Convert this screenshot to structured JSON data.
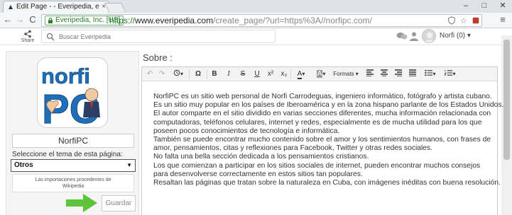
{
  "browser": {
    "tab_title": "Edit Page - - Everipedia, e",
    "tab_close": "×",
    "window_minimize": "–",
    "window_maximize": "□",
    "window_close": "✕",
    "back": "←",
    "forward": "→",
    "reload": "C",
    "ev_badge": "Everipedia, Inc. [US]",
    "url_https": "https://",
    "url_domain": "www.everipedia.com",
    "url_path": "/create_page/?url=https%3A//norfipc.com/",
    "menu": "≡"
  },
  "site": {
    "share_label": "Share",
    "search_placeholder": "Buscar Everipedia",
    "username": "Norfi",
    "notification_count": "(0)",
    "dropdown": "▾"
  },
  "sidebar": {
    "logo_text": [
      "norfi",
      "PC"
    ],
    "page_name": "NorfiPC",
    "theme_label": "Seleccione el tema de esta página:",
    "theme_selected": "Otros",
    "imports_button": [
      "Las importaciones procedentes de",
      "Wikipedia"
    ],
    "save_button": "Guardar"
  },
  "editor": {
    "section_title": "Sobre :",
    "toolbar": {
      "undo": "↶",
      "redo": "↷",
      "omega": "Ω",
      "bold": "B",
      "italic": "I",
      "strike": "S",
      "underline": "U",
      "superscript": "x²",
      "subscript": "x₂",
      "font_color": "A",
      "bg_color": "A",
      "formats": "Formats",
      "caret": "▾"
    },
    "lines": [
      "NorfiPC es un sitio web personal de Norfi Carrodeguas, ingeniero informático, fotógrafo y artista cubano.",
      "Es un sitio muy popular en los países de Iberoamérica y en la zona hispano parlante de los Estados Unidos.",
      "El autor comparte en el sitio dividido en varias secciones diferentes, mucha información relacionada con",
      "computadoras, teléfonos celulares, internet y redes, especialmente es de mucha utilidad para los que",
      "poseen pocos conocimientos de tecnología e informática.",
      "También se puede encontrar mucho contenido sobre el amor y los sentimientos humanos, con frases de",
      "amor, pensamientos, citas y reflexiones para Facebook, Twitter y otras redes sociales.",
      "No falta una bella sección dedicada a los pensamientos cristianos.",
      "Los que comienzan a participar en los sitios sociales de internet, pueden encontrar muchos consejos",
      "para desenvolverse correctamente en estos sitios tan populares.",
      "Resaltan las páginas que tratan sobre la naturaleza en Cuba, con imágenes inéditas con buena resolución."
    ]
  },
  "colors": {
    "ev_green": "#2b7a2b",
    "arrow_green": "#5cc33a",
    "logo_blue": "#1f6fb8"
  }
}
